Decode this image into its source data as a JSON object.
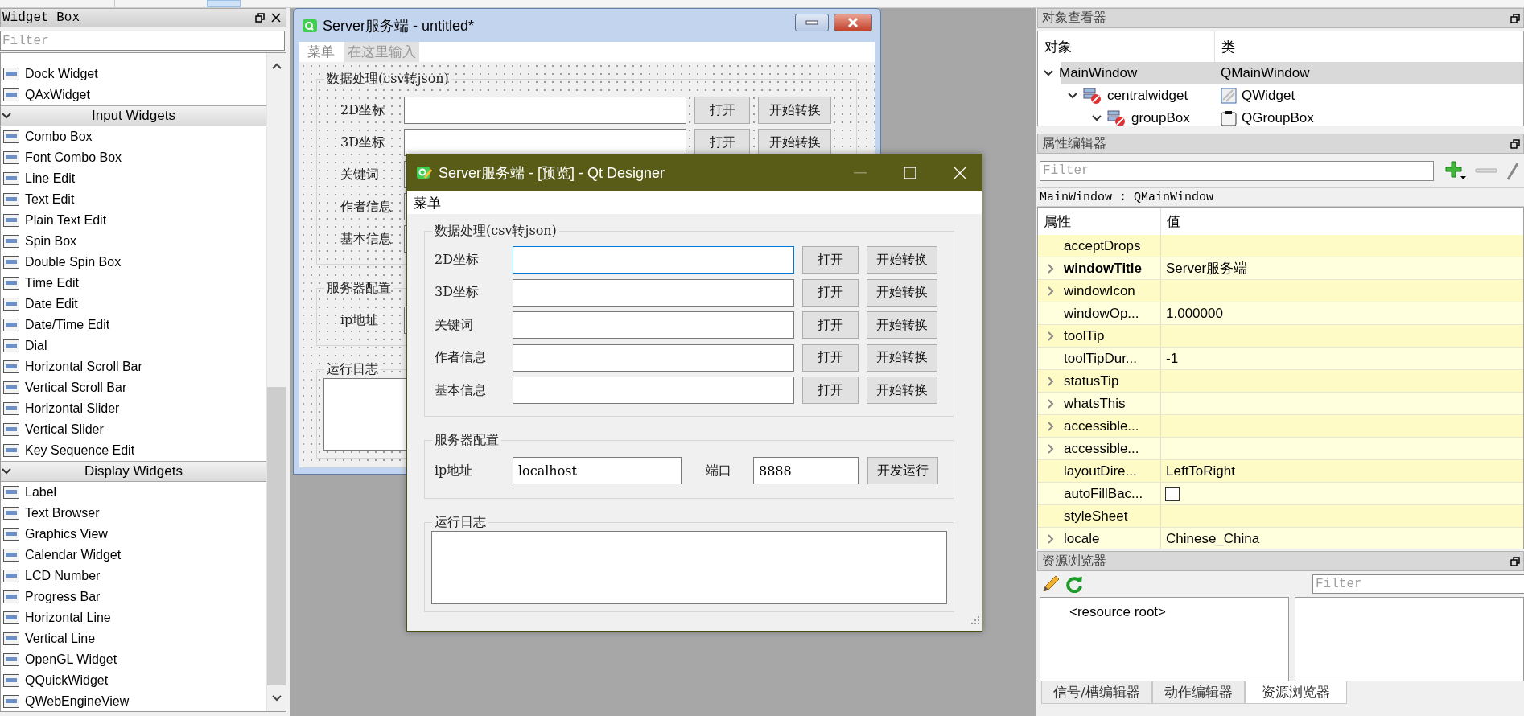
{
  "widget_box": {
    "title": "Widget Box",
    "filter_placeholder": "Filter",
    "leading_items": [
      "Dock Widget",
      "QAxWidget"
    ],
    "categories": [
      {
        "name": "Input Widgets",
        "expanded": true,
        "items": [
          "Combo Box",
          "Font Combo Box",
          "Line Edit",
          "Text Edit",
          "Plain Text Edit",
          "Spin Box",
          "Double Spin Box",
          "Time Edit",
          "Date Edit",
          "Date/Time Edit",
          "Dial",
          "Horizontal Scroll Bar",
          "Vertical Scroll Bar",
          "Horizontal Slider",
          "Vertical Slider",
          "Key Sequence Edit"
        ]
      },
      {
        "name": "Display Widgets",
        "expanded": true,
        "items": [
          "Label",
          "Text Browser",
          "Graphics View",
          "Calendar Widget",
          "LCD Number",
          "Progress Bar",
          "Horizontal Line",
          "Vertical Line",
          "OpenGL Widget",
          "QQuickWidget",
          "QWebEngineView"
        ]
      }
    ]
  },
  "form_window": {
    "title": "Server服务端 - untitled*",
    "menus": [
      {
        "label": "菜单",
        "kind": "menu"
      },
      {
        "label": "在这里输入",
        "kind": "placeholder"
      }
    ],
    "groups": [
      {
        "kind": "form",
        "title": "数据处理(csv转json)",
        "rows": [
          {
            "label": "2D坐标",
            "buttons": [
              "打开",
              "开始转换"
            ]
          },
          {
            "label": "3D坐标",
            "buttons": [
              "打开",
              "开始转换"
            ]
          },
          {
            "label": "关键词"
          },
          {
            "label": "作者信息"
          },
          {
            "label": "基本信息"
          }
        ]
      },
      {
        "kind": "server",
        "title": "服务器配置",
        "fields": [
          {
            "label": "ip地址"
          }
        ]
      },
      {
        "kind": "log",
        "title": "运行日志"
      }
    ]
  },
  "preview_window": {
    "title": "Server服务端 - [预览] - Qt Designer",
    "window_buttons": [
      {
        "kind": "minimize",
        "disabled": true
      },
      {
        "kind": "maximize",
        "disabled": false
      },
      {
        "kind": "close",
        "disabled": false
      }
    ],
    "menus": [
      {
        "label": "菜单",
        "kind": "menu"
      }
    ],
    "groups": [
      {
        "kind": "form",
        "title": "数据处理(csv转json)",
        "rows": [
          {
            "label": "2D坐标",
            "focused": true,
            "buttons": [
              "打开",
              "开始转换"
            ]
          },
          {
            "label": "3D坐标",
            "focused": false,
            "buttons": [
              "打开",
              "开始转换"
            ]
          },
          {
            "label": "关键词",
            "focused": false,
            "buttons": [
              "打开",
              "开始转换"
            ]
          },
          {
            "label": "作者信息",
            "focused": false,
            "buttons": [
              "打开",
              "开始转换"
            ]
          },
          {
            "label": "基本信息",
            "focused": false,
            "buttons": [
              "打开",
              "开始转换"
            ]
          }
        ]
      },
      {
        "kind": "server",
        "title": "服务器配置",
        "fields": [
          {
            "label": "ip地址",
            "value": "localhost"
          },
          {
            "label": "端口",
            "value": "8888"
          }
        ],
        "button": "开发运行"
      },
      {
        "kind": "log",
        "title": "运行日志"
      }
    ]
  },
  "object_inspector": {
    "title": "对象查看器",
    "columns": [
      "对象",
      "类"
    ],
    "tree": [
      {
        "name": "MainWindow",
        "class": "QMainWindow",
        "selected": true,
        "expanded": true,
        "children": [
          {
            "name": "centralwidget",
            "class": "QWidget",
            "selected": false,
            "expanded": true,
            "children": [
              {
                "name": "groupBox",
                "class": "QGroupBox",
                "selected": false,
                "expanded": true
              }
            ]
          }
        ]
      }
    ]
  },
  "property_editor": {
    "title": "属性编辑器",
    "filter_placeholder": "Filter",
    "object_label": "MainWindow : QMainWindow",
    "columns": [
      "属性",
      "值"
    ],
    "properties": [
      {
        "name": "acceptDrops",
        "kind": "text",
        "expandable": false,
        "modified": false
      },
      {
        "name": "windowTitle",
        "kind": "text",
        "value": "Server服务端",
        "expandable": true,
        "modified": true
      },
      {
        "name": "windowIcon",
        "kind": "text",
        "expandable": true,
        "modified": false
      },
      {
        "name": "windowOp...",
        "kind": "text",
        "value": "1.000000",
        "expandable": false,
        "modified": false
      },
      {
        "name": "toolTip",
        "kind": "text",
        "expandable": true,
        "modified": false
      },
      {
        "name": "toolTipDur...",
        "kind": "text",
        "value": "-1",
        "expandable": false,
        "modified": false
      },
      {
        "name": "statusTip",
        "kind": "text",
        "expandable": true,
        "modified": false
      },
      {
        "name": "whatsThis",
        "kind": "text",
        "expandable": true,
        "modified": false
      },
      {
        "name": "accessible...",
        "kind": "text",
        "expandable": true,
        "modified": false
      },
      {
        "name": "accessible...",
        "kind": "text",
        "expandable": true,
        "modified": false
      },
      {
        "name": "layoutDire...",
        "kind": "text",
        "value": "LeftToRight",
        "expandable": false,
        "modified": false
      },
      {
        "name": "autoFillBac...",
        "kind": "checkbox",
        "checked": false,
        "expandable": false,
        "modified": false
      },
      {
        "name": "styleSheet",
        "kind": "text",
        "expandable": false,
        "modified": false
      },
      {
        "name": "locale",
        "kind": "text",
        "value": "Chinese_China",
        "expandable": true,
        "modified": false
      }
    ]
  },
  "resource_browser": {
    "title": "资源浏览器",
    "filter_placeholder": "Filter",
    "items": [
      "<resource root>"
    ]
  },
  "bottom_tabs": [
    {
      "label": "信号/槽编辑器",
      "selected": false
    },
    {
      "label": "动作编辑器",
      "selected": false
    },
    {
      "label": "资源浏览器",
      "selected": true
    }
  ]
}
